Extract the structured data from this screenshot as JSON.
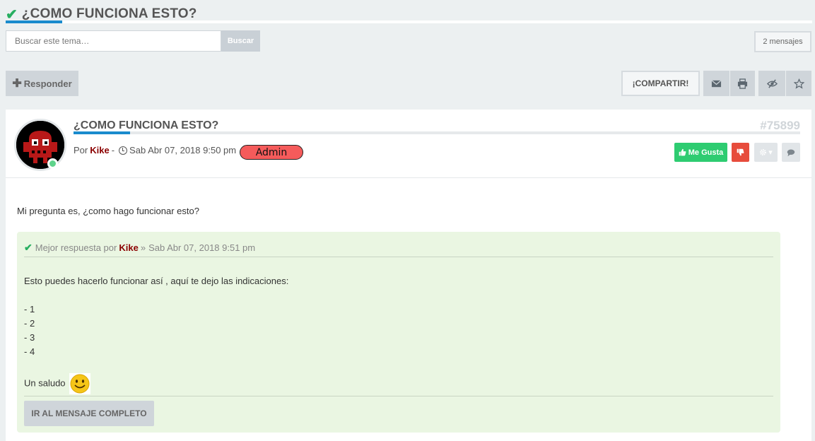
{
  "topic": {
    "title": "¿COMO FUNCIONA ESTO?"
  },
  "search": {
    "placeholder": "Buscar este tema…",
    "button_label": "Buscar"
  },
  "message_count": "2 mensajes",
  "toolbar": {
    "reply_label": "Responder",
    "share_label": "¡COMPARTIR!",
    "icons": [
      "envelope-icon",
      "print-icon",
      "eye-slash-icon",
      "star-icon"
    ]
  },
  "post": {
    "title": "¿COMO FUNCIONA ESTO?",
    "id": "#75899",
    "by_label": "Por",
    "author": "Kike",
    "separator": "-",
    "date": "Sab Abr 07, 2018 9:50 pm",
    "rank": "Admin",
    "like_label": "Me Gusta",
    "body": "Mi pregunta es, ¿como hago funcionar esto?",
    "colors": {
      "like": "#2ecc71",
      "dislike": "#e74c3c",
      "accent": "#1a8bcd",
      "online": "#5fd38b"
    }
  },
  "best_answer": {
    "prefix": "Mejor respuesta por",
    "author": "Kike",
    "separator": "»",
    "date": "Sab Abr 07, 2018 9:51 pm",
    "intro": "Esto puedes hacerlo funcionar así , aquí te dejo las indicaciones:",
    "items": [
      "- 1",
      "- 2",
      "- 3",
      "- 4"
    ],
    "closing": "Un saludo",
    "button_label": "IR AL MENSAJE COMPLETO"
  }
}
